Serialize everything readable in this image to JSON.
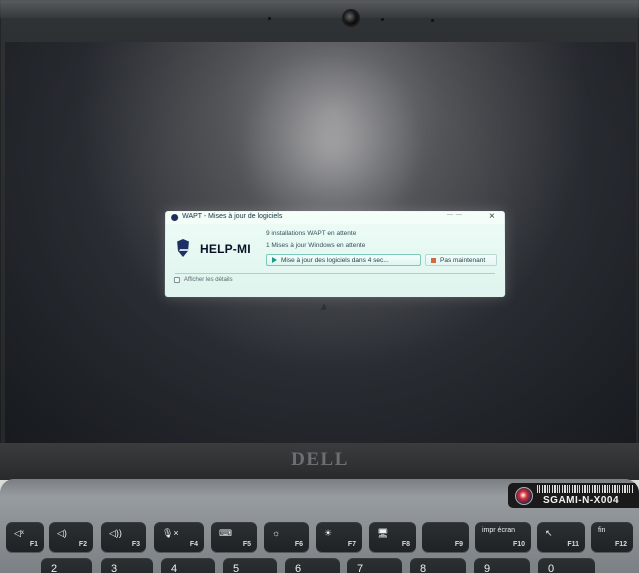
{
  "window": {
    "title": "WAPT - Mises à jour de logiciels",
    "brand": "HELP-MI",
    "message_1": "9 installations WAPT en attente",
    "message_2": "1 Mises à jour Windows en attente",
    "primary_button": "Mise à jour des logiciels dans 4 sec...",
    "secondary_button": "Pas maintenant",
    "details_label": "Afficher les détails"
  },
  "device": {
    "brand_logo": "DELL",
    "asset_tag": "SGAMI-N-X004"
  },
  "keyboard": {
    "function_keys": [
      {
        "top": "◁ˣ",
        "label": "F1"
      },
      {
        "top": "◁)",
        "label": "F2"
      },
      {
        "top": "◁))",
        "label": "F3"
      },
      {
        "top": "🎙×",
        "label": "F4"
      },
      {
        "top": "⌨",
        "label": "F5"
      },
      {
        "top": "☼",
        "label": "F6"
      },
      {
        "top": "☀",
        "label": "F7"
      },
      {
        "top": "🖥",
        "label": "F8"
      },
      {
        "top": "",
        "label": "F9"
      },
      {
        "top": "impr écran",
        "label": "F10"
      },
      {
        "top": "↖",
        "label": "F11"
      },
      {
        "top": "fin",
        "label": "F12"
      }
    ],
    "number_keys": [
      "2",
      "3",
      "4",
      "5",
      "6",
      "7",
      "8",
      "9",
      "0"
    ]
  },
  "icons": {
    "window": "wapt-app-icon",
    "logo": "shield-icon",
    "primary_action": "play-icon",
    "secondary_action": "stop-icon",
    "details": "details-toggle-icon",
    "cursor": "cursor-icon",
    "close": "close-icon"
  }
}
